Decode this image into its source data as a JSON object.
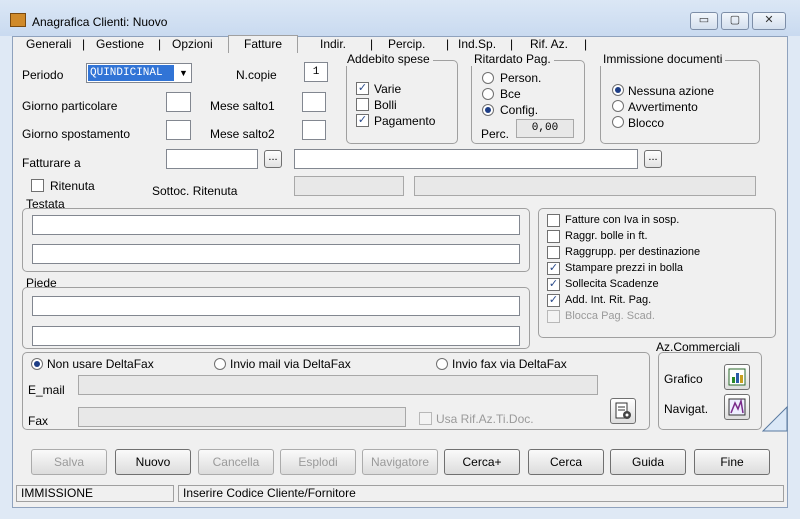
{
  "window": {
    "title": "Anagrafica Clienti: Nuovo",
    "minimize": "▭",
    "maximize": "▢",
    "close": "✕"
  },
  "tabs": [
    "Generali",
    "Gestione",
    "Opzioni",
    "Fatture",
    "Indir.",
    "Percip.",
    "Ind.Sp.",
    "Rif. Az."
  ],
  "tab_separator": "|",
  "periodo": {
    "label": "Periodo",
    "value": "QUINDICINAL"
  },
  "ncopie": {
    "label": "N.copie",
    "value": "1"
  },
  "giorno_particolare": {
    "label": "Giorno particolare",
    "value": ""
  },
  "mese_salto1": {
    "label": "Mese salto1",
    "value": ""
  },
  "giorno_spostamento": {
    "label": "Giorno spostamento",
    "value": ""
  },
  "mese_salto2": {
    "label": "Mese salto2",
    "value": ""
  },
  "addebito": {
    "title": "Addebito spese",
    "items": [
      {
        "label": "Varie",
        "checked": true
      },
      {
        "label": "Bolli",
        "checked": false
      },
      {
        "label": "Pagamento",
        "checked": true
      }
    ]
  },
  "ritardato": {
    "title": "Ritardato Pag.",
    "options": [
      {
        "label": "Person.",
        "selected": false
      },
      {
        "label": "Bce",
        "selected": false
      },
      {
        "label": "Config.",
        "selected": true
      }
    ],
    "perc_label": "Perc.",
    "perc_value": "0,00"
  },
  "immissione": {
    "title": "Immissione documenti",
    "options": [
      {
        "label": "Nessuna azione",
        "selected": true
      },
      {
        "label": "Avvertimento",
        "selected": false
      },
      {
        "label": "Blocco",
        "selected": false
      }
    ]
  },
  "fatturare": {
    "label": "Fatturare a",
    "code": "",
    "name": "",
    "ellipsis": "..."
  },
  "ritenuta": {
    "label": "Ritenuta",
    "checked": false,
    "sottoc_label": "Sottoc. Ritenuta"
  },
  "testata": {
    "label": "Testata",
    "line1": "",
    "line2": ""
  },
  "piede": {
    "label": "Piede",
    "line1": "",
    "line2": ""
  },
  "options_box": [
    {
      "label": "Fatture con Iva in sosp.",
      "checked": false,
      "disabled": false
    },
    {
      "label": "Raggr. bolle in ft.",
      "checked": false,
      "disabled": false
    },
    {
      "label": "Raggrupp. per destinazione",
      "checked": false,
      "disabled": false
    },
    {
      "label": "Stampare prezzi in bolla",
      "checked": true,
      "disabled": false
    },
    {
      "label": "Sollecita Scadenze",
      "checked": true,
      "disabled": false
    },
    {
      "label": "Add. Int. Rit. Pag.",
      "checked": true,
      "disabled": false
    },
    {
      "label": "Blocca Pag. Scad.",
      "checked": false,
      "disabled": true
    }
  ],
  "deltafax": {
    "options": [
      {
        "label": "Non usare DeltaFax",
        "selected": true
      },
      {
        "label": "Invio mail via DeltaFax",
        "selected": false
      },
      {
        "label": "Invio fax via DeltaFax",
        "selected": false
      }
    ],
    "email_label": "E_mail",
    "fax_label": "Fax",
    "usa_rif": "Usa Rif.Az.Ti.Doc."
  },
  "az_commerciali": {
    "title": "Az.Commerciali",
    "grafico": "Grafico",
    "navigat": "Navigat."
  },
  "buttons": [
    {
      "label": "Salva",
      "enabled": false
    },
    {
      "label": "Nuovo",
      "enabled": true
    },
    {
      "label": "Cancella",
      "enabled": false
    },
    {
      "label": "Esplodi",
      "enabled": false
    },
    {
      "label": "Navigatore",
      "enabled": false
    },
    {
      "label": "Cerca+",
      "enabled": true
    },
    {
      "label": "Cerca",
      "enabled": true
    },
    {
      "label": "Guida",
      "enabled": true
    },
    {
      "label": "Fine",
      "enabled": true
    }
  ],
  "status": {
    "mode": "IMMISSIONE",
    "hint": "Inserire Codice Cliente/Fornitore"
  },
  "check_mark": "✓",
  "dropdown_arrow": "▼"
}
